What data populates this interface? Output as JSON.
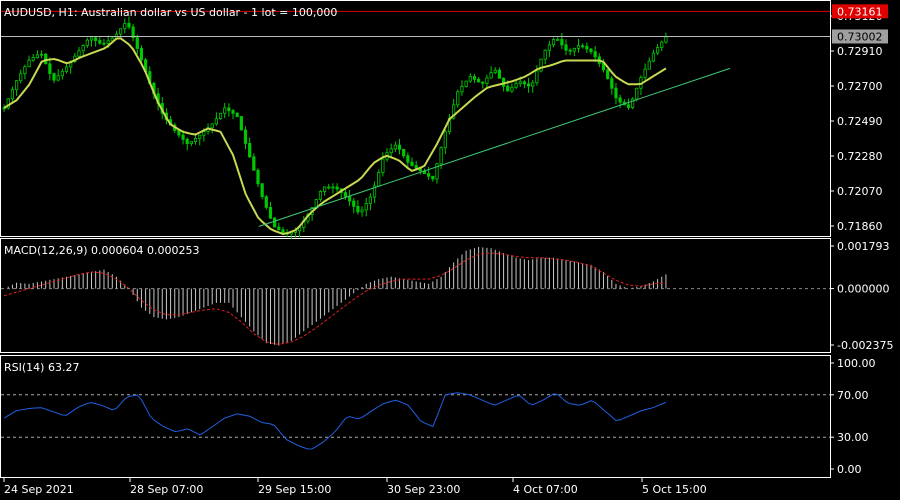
{
  "window": {
    "symbol_title": "AUDUSD, H1:  Australian dollar vs US dollar - 1 lot = 100,000"
  },
  "colors": {
    "background": "#000000",
    "frame": "#ffffff",
    "candle": "#00c800",
    "moving_average": "#c8d850",
    "trendline": "#3cc878",
    "macd_hist": "#c8c8c8",
    "macd_signal": "#e02020",
    "rsi_line": "#2060e0",
    "current_price_badge": "#a0a0a0",
    "high_price_badge": "#e00000"
  },
  "price_panel": {
    "ticks": [
      "0.73120",
      "0.72910",
      "0.72700",
      "0.72490",
      "0.72280",
      "0.72070",
      "0.71860"
    ],
    "current_price_label": "0.73002",
    "high_price_label": "0.73161"
  },
  "macd_panel": {
    "label": "MACD(12,26,9) 0.000604 0.000253",
    "ticks": [
      "0.001793",
      "0.000000",
      "-0.002375"
    ]
  },
  "rsi_panel": {
    "label": "RSI(14) 63.27",
    "ticks": [
      "100.00",
      "70.00",
      "30.00",
      "0.00"
    ]
  },
  "time_axis": {
    "labels": [
      "24 Sep 2021",
      "28 Sep 07:00",
      "29 Sep 15:00",
      "30 Sep 23:00",
      "4 Oct 07:00",
      "5 Oct 15:00"
    ]
  },
  "chart_data": [
    {
      "type": "candlestick",
      "title": "AUDUSD, H1:  Australian dollar vs US dollar - 1 lot = 100,000",
      "x_labels": [
        "24 Sep 2021",
        "28 Sep 07:00",
        "29 Sep 15:00",
        "30 Sep 23:00",
        "4 Oct 07:00",
        "5 Oct 15:00"
      ],
      "ylim": [
        0.7174,
        0.7322
      ],
      "close_anchors": [
        0.7255,
        0.7272,
        0.7285,
        0.729,
        0.7272,
        0.728,
        0.729,
        0.73,
        0.7295,
        0.73,
        0.731,
        0.729,
        0.7268,
        0.725,
        0.724,
        0.7232,
        0.7238,
        0.7245,
        0.7255,
        0.725,
        0.7225,
        0.72,
        0.718,
        0.7175,
        0.7178,
        0.719,
        0.7205,
        0.7205,
        0.7198,
        0.7188,
        0.72,
        0.7225,
        0.7232,
        0.722,
        0.7215,
        0.721,
        0.724,
        0.7265,
        0.7275,
        0.727,
        0.728,
        0.7265,
        0.7272,
        0.7268,
        0.729,
        0.73,
        0.729,
        0.7295,
        0.729,
        0.7278,
        0.726,
        0.7255,
        0.7275,
        0.729,
        0.73
      ],
      "moving_average_anchors": [
        0.7255,
        0.726,
        0.727,
        0.7285,
        0.7286,
        0.7283,
        0.7287,
        0.729,
        0.7293,
        0.73,
        0.7294,
        0.728,
        0.726,
        0.7245,
        0.724,
        0.7238,
        0.7242,
        0.724,
        0.7225,
        0.72,
        0.7185,
        0.7178,
        0.7175,
        0.7178,
        0.7188,
        0.7195,
        0.72,
        0.7205,
        0.721,
        0.722,
        0.7225,
        0.7222,
        0.7215,
        0.7218,
        0.7232,
        0.7248,
        0.7255,
        0.7262,
        0.7268,
        0.727,
        0.7272,
        0.7275,
        0.728,
        0.7282,
        0.7285,
        0.7285,
        0.7285,
        0.7285,
        0.7275,
        0.727,
        0.727,
        0.7275,
        0.728
      ],
      "trendline": {
        "from": [
          0.3855,
          0.718
        ],
        "to": [
          0.9307,
          0.728
        ]
      },
      "current_price": 0.73002,
      "high_price": 0.73161
    },
    {
      "type": "bar",
      "title": "MACD(12,26,9) 0.000604 0.000253",
      "ylim": [
        -0.002375,
        0.001793
      ],
      "macd_anchors": [
        0.0,
        0.00025,
        0.0002,
        0.0003,
        0.0004,
        0.0005,
        0.0006,
        0.0007,
        0.0008,
        0.0005,
        0.0,
        -0.0008,
        -0.0012,
        -0.0013,
        -0.0012,
        -0.001,
        -0.0008,
        -0.0006,
        -0.0006,
        -0.0012,
        -0.0018,
        -0.0023,
        -0.0024,
        -0.0022,
        -0.0018,
        -0.0014,
        -0.001,
        -0.0006,
        -0.0002,
        0.0002,
        0.0004,
        0.0005,
        0.0004,
        0.0003,
        0.0002,
        0.0005,
        0.0011,
        0.0016,
        0.00175,
        0.0017,
        0.0015,
        0.0013,
        0.0012,
        0.0013,
        0.0013,
        0.0012,
        0.0011,
        0.001,
        0.0007,
        0.0002,
        0.0,
        0.0001,
        0.0003,
        0.0006
      ],
      "signal_anchors": [
        -0.0003,
        -0.00015,
        0.0,
        0.00015,
        0.0003,
        0.00045,
        0.0006,
        0.0007,
        0.00065,
        0.0004,
        0.0,
        -0.0005,
        -0.0009,
        -0.0011,
        -0.0011,
        -0.001,
        -0.0009,
        -0.00085,
        -0.001,
        -0.0014,
        -0.0019,
        -0.00225,
        -0.00235,
        -0.00225,
        -0.002,
        -0.00165,
        -0.00125,
        -0.00085,
        -0.00045,
        -0.0001,
        0.00015,
        0.0003,
        0.0004,
        0.0004,
        0.0004,
        0.00055,
        0.00085,
        0.0012,
        0.00145,
        0.0015,
        0.00145,
        0.00135,
        0.0013,
        0.0013,
        0.00125,
        0.0012,
        0.0011,
        0.00095,
        0.00065,
        0.00035,
        0.00015,
        0.0001,
        0.0002,
        0.00025
      ]
    },
    {
      "type": "line",
      "title": "RSI(14) 63.27",
      "ylim": [
        0,
        100
      ],
      "levels": [
        70,
        30
      ],
      "rsi_anchors": [
        48,
        55,
        57,
        58,
        54,
        50,
        58,
        63,
        60,
        55,
        68,
        70,
        48,
        40,
        35,
        38,
        32,
        40,
        48,
        52,
        50,
        44,
        42,
        28,
        22,
        18,
        25,
        35,
        50,
        47,
        55,
        62,
        65,
        60,
        45,
        40,
        70,
        72,
        70,
        65,
        60,
        65,
        70,
        60,
        65,
        72,
        62,
        60,
        65,
        55,
        45,
        50,
        55,
        58,
        63
      ]
    }
  ]
}
